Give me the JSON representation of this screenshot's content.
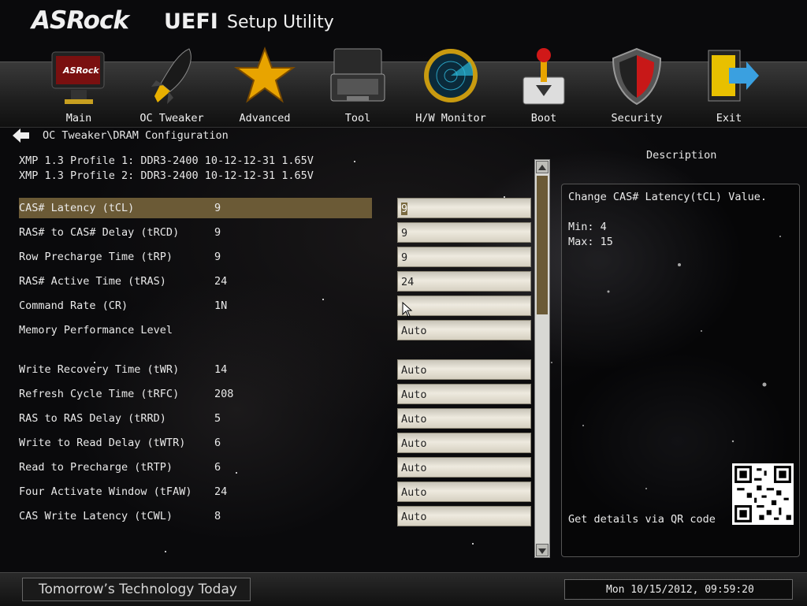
{
  "header": {
    "brand": "ASRock",
    "uefi": "UEFI",
    "setup": "Setup Utility"
  },
  "nav": [
    {
      "label": "Main",
      "icon": "monitor-icon"
    },
    {
      "label": "OC Tweaker",
      "icon": "rocket-icon"
    },
    {
      "label": "Advanced",
      "icon": "star-icon"
    },
    {
      "label": "Tool",
      "icon": "toolbox-icon"
    },
    {
      "label": "H/W Monitor",
      "icon": "radar-icon"
    },
    {
      "label": "Boot",
      "icon": "power-lever-icon"
    },
    {
      "label": "Security",
      "icon": "shield-icon"
    },
    {
      "label": "Exit",
      "icon": "exit-door-icon"
    }
  ],
  "breadcrumb": "OC Tweaker\\DRAM Configuration",
  "xmp": [
    "XMP 1.3 Profile 1: DDR3-2400 10-12-12-31 1.65V",
    "XMP 1.3 Profile 2: DDR3-2400 10-12-12-31 1.65V"
  ],
  "settings": [
    {
      "name": "CAS# Latency (tCL)",
      "current": "9",
      "field": "9"
    },
    {
      "name": "RAS# to CAS# Delay (tRCD)",
      "current": "9",
      "field": "9"
    },
    {
      "name": "Row Precharge Time (tRP)",
      "current": "9",
      "field": "9"
    },
    {
      "name": "RAS# Active Time (tRAS)",
      "current": "24",
      "field": "24"
    },
    {
      "name": "Command Rate (CR)",
      "current": "1N",
      "field": ""
    },
    {
      "name": "Memory Performance Level",
      "current": "",
      "field": "Auto"
    },
    {
      "name": "Write Recovery Time (tWR)",
      "current": "14",
      "field": "Auto"
    },
    {
      "name": "Refresh Cycle Time (tRFC)",
      "current": "208",
      "field": "Auto"
    },
    {
      "name": "RAS to RAS Delay (tRRD)",
      "current": "5",
      "field": "Auto"
    },
    {
      "name": "Write to Read Delay (tWTR)",
      "current": "6",
      "field": "Auto"
    },
    {
      "name": "Read to Precharge (tRTP)",
      "current": "6",
      "field": "Auto"
    },
    {
      "name": "Four Activate Window (tFAW)",
      "current": "24",
      "field": "Auto"
    },
    {
      "name": "CAS Write Latency (tCWL)",
      "current": "8",
      "field": "Auto"
    }
  ],
  "description": {
    "title": "Description",
    "text": "Change CAS# Latency(tCL) Value.",
    "min": "Min: 4",
    "max": "Max: 15",
    "qr_label": "Get details via QR code"
  },
  "footer": {
    "slogan": "Tomorrow’s Technology Today",
    "datetime": "Mon 10/15/2012, 09:59:20"
  },
  "colors": {
    "selection": "#6b5a36",
    "field": "#eeeadf"
  }
}
